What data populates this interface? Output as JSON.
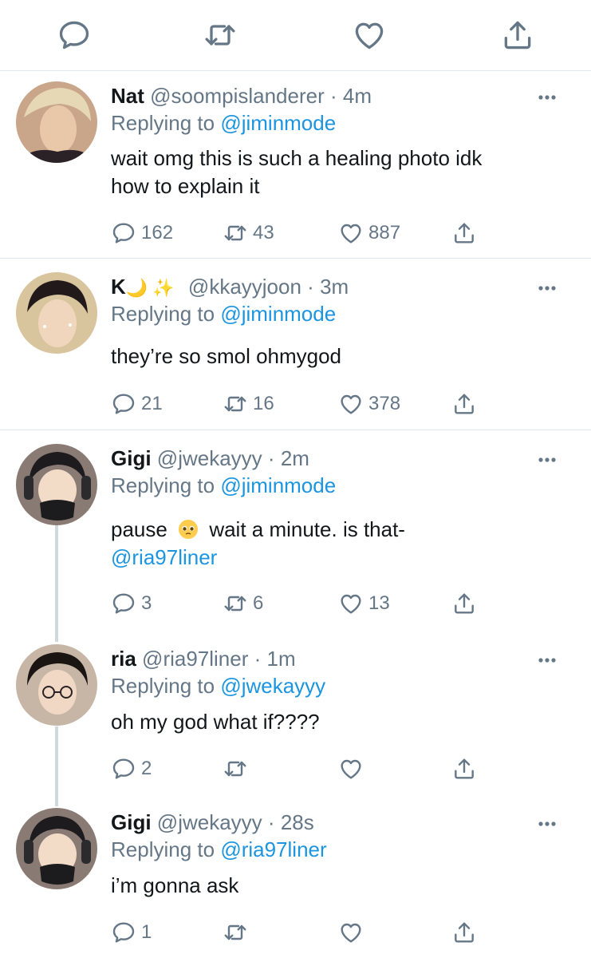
{
  "colors": {
    "accent": "#1b95e0",
    "muted": "#657786",
    "text": "#14171a",
    "divider": "#e1e8ed"
  },
  "top_actions": [
    "reply-icon",
    "retweet-icon",
    "like-icon",
    "share-icon"
  ],
  "tweets": [
    {
      "name": "Nat",
      "handle": "@soompislanderer",
      "time": "4m",
      "replying_prefix": "Replying to",
      "replying_to": "@jiminmode",
      "text_lines": [
        "wait omg this is such a healing photo idk",
        "how to explain it"
      ],
      "replies": "162",
      "retweets": "43",
      "likes": "887"
    },
    {
      "name": "K",
      "name_emoji": "🌙 ✨",
      "handle": "@kkayyjoon",
      "time": "3m",
      "replying_prefix": "Replying to",
      "replying_to": "@jiminmode",
      "text_lines": [
        "they’re so smol ohmygod"
      ],
      "replies": "21",
      "retweets": "16",
      "likes": "378"
    },
    {
      "name": "Gigi",
      "handle": "@jwekayyy",
      "time": "2m",
      "replying_prefix": "Replying to",
      "replying_to": "@jiminmode",
      "text_before_emoji": "pause",
      "emoji": "pleading-face",
      "text_after_emoji": "wait a minute. is that-",
      "mention_line": "@ria97liner",
      "replies": "3",
      "retweets": "6",
      "likes": "13"
    },
    {
      "name": "ria",
      "handle": "@ria97liner",
      "time": "1m",
      "replying_prefix": "Replying to",
      "replying_to": "@jwekayyy",
      "text_lines": [
        "oh my god what if????"
      ],
      "replies": "2",
      "retweets": "",
      "likes": ""
    },
    {
      "name": "Gigi",
      "handle": "@jwekayyy",
      "time": "28s",
      "replying_prefix": "Replying to",
      "replying_to": "@ria97liner",
      "text_lines": [
        "i’m gonna ask"
      ],
      "replies": "1",
      "retweets": "",
      "likes": ""
    }
  ]
}
